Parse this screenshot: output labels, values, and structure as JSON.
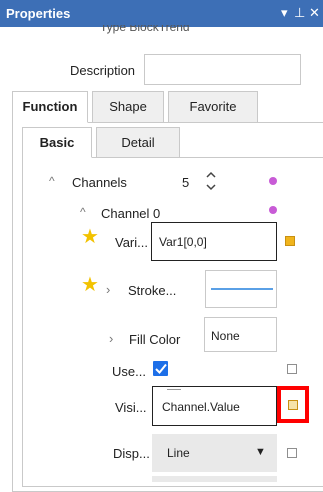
{
  "panel": {
    "title": "Properties",
    "pin_glyph": "▾ ⊥ ✕",
    "cut_text": "Type BlockTrend"
  },
  "description": {
    "label": "Description",
    "value": ""
  },
  "tabs": [
    {
      "label": "Function",
      "active": true
    },
    {
      "label": "Shape",
      "active": false
    },
    {
      "label": "Favorite",
      "active": false
    }
  ],
  "subtabs": [
    {
      "label": "Basic",
      "active": true
    },
    {
      "label": "Detail",
      "active": false
    }
  ],
  "props": {
    "channels": {
      "label": "Channels",
      "value": "5",
      "dot_color": "#c85bd6"
    },
    "channel0": {
      "label": "Channel 0",
      "dot_color": "#c85bd6"
    },
    "vari": {
      "label": "Vari...",
      "value": "Var1[0,0]",
      "marker_color": "#f0b41c"
    },
    "stroke": {
      "label": "Stroke...",
      "line_color": "#5aa0e6"
    },
    "fill": {
      "label": "Fill Color",
      "value": "None"
    },
    "use": {
      "label": "Use...",
      "checked": true
    },
    "visi": {
      "label": "Visi...",
      "value": "Channel.Value",
      "marker_color": "#f0b41c"
    },
    "disp": {
      "label": "Disp...",
      "value": "Line"
    }
  },
  "accent": {
    "title_bg": "#3d6fb6",
    "highlight": "#ff0000",
    "star": "#f2c200",
    "check": "#1d6fe8"
  }
}
